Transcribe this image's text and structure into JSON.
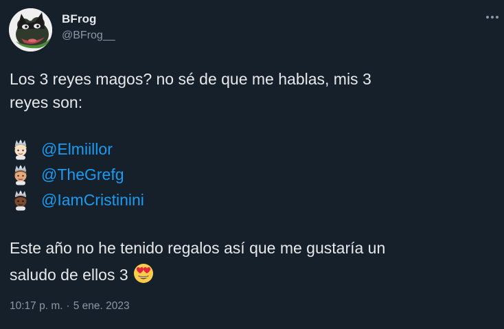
{
  "author": {
    "name": "BFrog",
    "handle": "@BFrog__"
  },
  "tweet": {
    "line1": "Los 3 reyes magos? no sé de que me hablas, mis 3",
    "line2": "reyes son:",
    "mentions": [
      {
        "emoji": "prince-light-skin-tone",
        "text": "@Elmiillor"
      },
      {
        "emoji": "prince-medium-skin-tone",
        "text": "@TheGrefg"
      },
      {
        "emoji": "prince-dark-skin-tone",
        "text": "@IamCristinini"
      }
    ],
    "line5": "Este año no he tenido regalos así que me gustaría un",
    "line6": "saludo de ellos 3",
    "trailing_emoji": "smiling-face-with-heart-eyes"
  },
  "meta": {
    "time": "10:17 p. m.",
    "separator": "·",
    "date": "5 ene. 2023"
  },
  "colors": {
    "background": "#15202b",
    "text": "#e7e9ea",
    "secondary": "#8b98a5",
    "link": "#1d9bf0"
  }
}
